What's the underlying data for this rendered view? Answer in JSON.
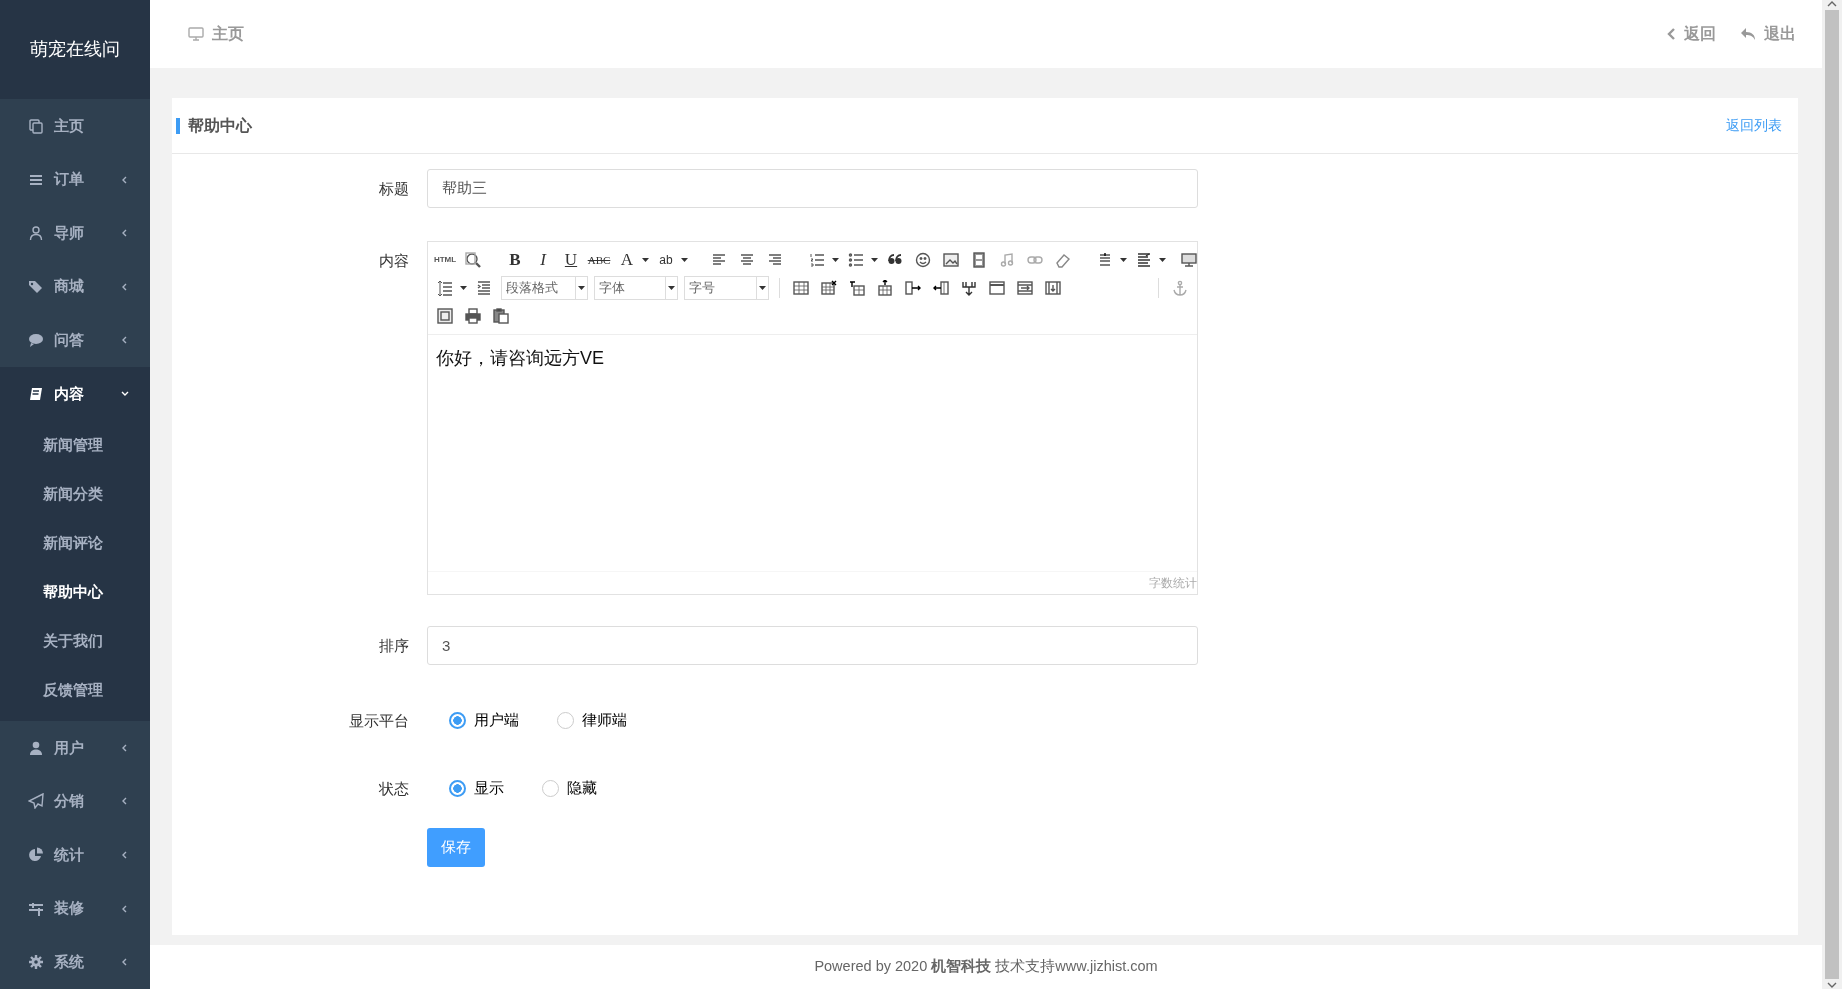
{
  "sidebar": {
    "brand": "萌宠在线问",
    "items": [
      {
        "label": "主页",
        "has_children": false,
        "expanded": false
      },
      {
        "label": "订单",
        "has_children": true,
        "expanded": false
      },
      {
        "label": "导师",
        "has_children": true,
        "expanded": false
      },
      {
        "label": "商城",
        "has_children": true,
        "expanded": false
      },
      {
        "label": "问答",
        "has_children": true,
        "expanded": false
      },
      {
        "label": "内容",
        "has_children": true,
        "expanded": true,
        "children": [
          {
            "label": "新闻管理",
            "selected": false
          },
          {
            "label": "新闻分类",
            "selected": false
          },
          {
            "label": "新闻评论",
            "selected": false
          },
          {
            "label": "帮助中心",
            "selected": true
          },
          {
            "label": "关于我们",
            "selected": false
          },
          {
            "label": "反馈管理",
            "selected": false
          }
        ]
      },
      {
        "label": "用户",
        "has_children": true,
        "expanded": false
      },
      {
        "label": "分销",
        "has_children": true,
        "expanded": false
      },
      {
        "label": "统计",
        "has_children": true,
        "expanded": false
      },
      {
        "label": "装修",
        "has_children": true,
        "expanded": false
      },
      {
        "label": "系统",
        "has_children": true,
        "expanded": false
      }
    ]
  },
  "topbar": {
    "breadcrumb": "主页",
    "back": "返回",
    "logout": "退出"
  },
  "card": {
    "title": "帮助中心",
    "back_link": "返回列表"
  },
  "form": {
    "title_label": "标题",
    "title_value": "帮助三",
    "content_label": "内容",
    "editor": {
      "glyphs": [
        "HTML",
        "B",
        "I",
        "U",
        "ABC",
        "A",
        "ab"
      ],
      "dropdowns": [
        "段落格式",
        "字体",
        "字号"
      ],
      "content": "你好，请咨询远方VE",
      "word_count": "字数统计"
    },
    "sort_label": "排序",
    "sort_value": "3",
    "platform": {
      "label": "显示平台",
      "options": [
        {
          "label": "用户端",
          "selected": true
        },
        {
          "label": "律师端",
          "selected": false
        }
      ]
    },
    "status": {
      "label": "状态",
      "options": [
        {
          "label": "显示",
          "selected": true
        },
        {
          "label": "隐藏",
          "selected": false
        }
      ]
    },
    "save": "保存"
  },
  "footer": "Powered by 2020 **机智科技** 技术支持www.jizhist.com"
}
